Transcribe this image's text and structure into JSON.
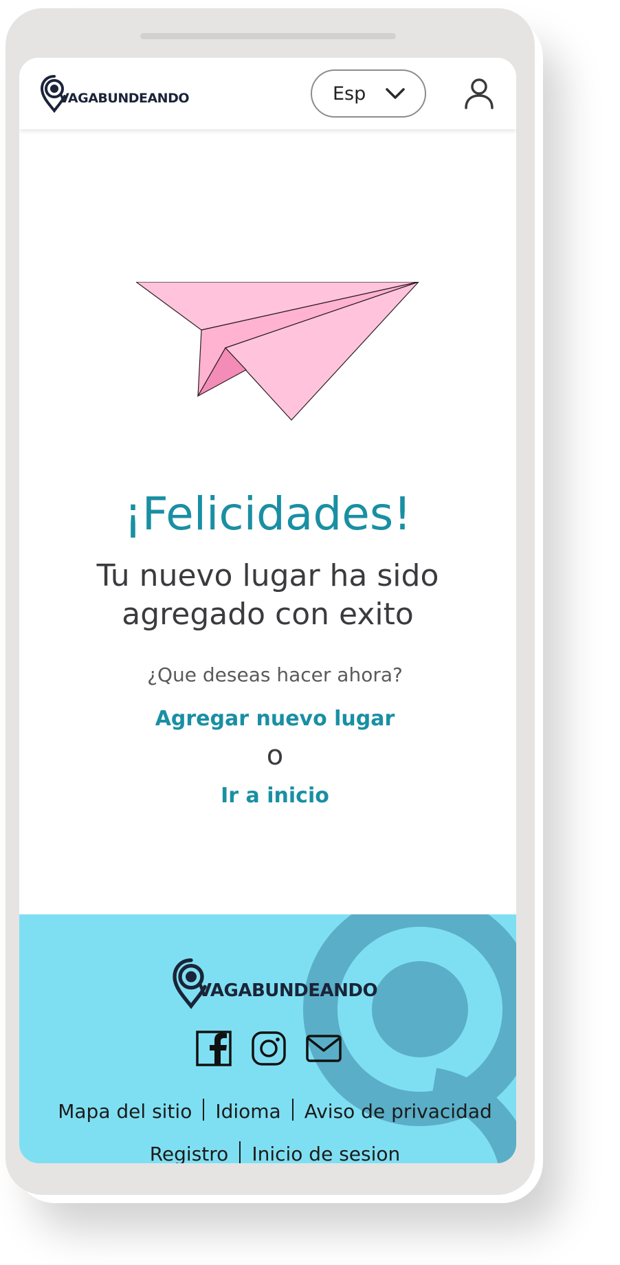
{
  "header": {
    "brand": "VAGABUNDEANDO",
    "language": "Esp"
  },
  "main": {
    "title": "¡Felicidades!",
    "subtitle": "Tu nuevo lugar ha sido agregado con exito",
    "question": "¿Que deseas hacer ahora?",
    "add_place_link": "Agregar nuevo lugar",
    "or_text": "o",
    "home_link": "Ir a inicio"
  },
  "footer": {
    "brand": "VAGABUNDEANDO",
    "links_row1": [
      "Mapa del sitio",
      "Idioma",
      "Aviso de privacidad"
    ],
    "links_row2": [
      "Registro",
      "Inicio de sesion"
    ]
  },
  "colors": {
    "accent": "#1a8fa3",
    "footer_bg": "#7fdff2",
    "plane_pink": "#ffc4dc",
    "plane_dark_pink": "#f38cb6",
    "brand_navy": "#1b2438"
  },
  "icons": {
    "header": [
      "logo-pin-icon",
      "chevron-down-icon",
      "user-icon"
    ],
    "footer": [
      "facebook-icon",
      "instagram-icon",
      "mail-icon"
    ]
  }
}
